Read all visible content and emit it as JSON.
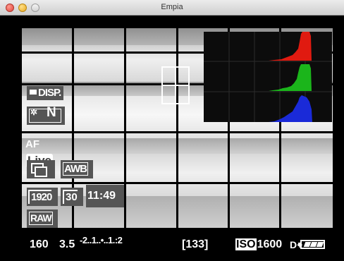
{
  "window": {
    "title": "Empia"
  },
  "viewfinder": {
    "histogram": {
      "channels": [
        "red",
        "green",
        "blue"
      ],
      "colors": {
        "red": "#e01a10",
        "green": "#1bb51b",
        "blue": "#1a2ad8"
      }
    }
  },
  "overlay": {
    "disp": "DISP.",
    "picture_style": "N",
    "af_prefix": "AF",
    "af_mode": "Live",
    "white_balance": "AWB",
    "movie_size": "1920",
    "frame_rate": "30",
    "recording_time": "11:49",
    "quality": "RAW"
  },
  "status_bar": {
    "shutter": "160",
    "aperture": "3.5",
    "exposure_scale": "-2..1..•..1.:2",
    "shots_remaining": "[133]",
    "iso_label": "ISO",
    "iso_value": "1600",
    "d_plus": "D+",
    "battery_level": 1.0
  }
}
